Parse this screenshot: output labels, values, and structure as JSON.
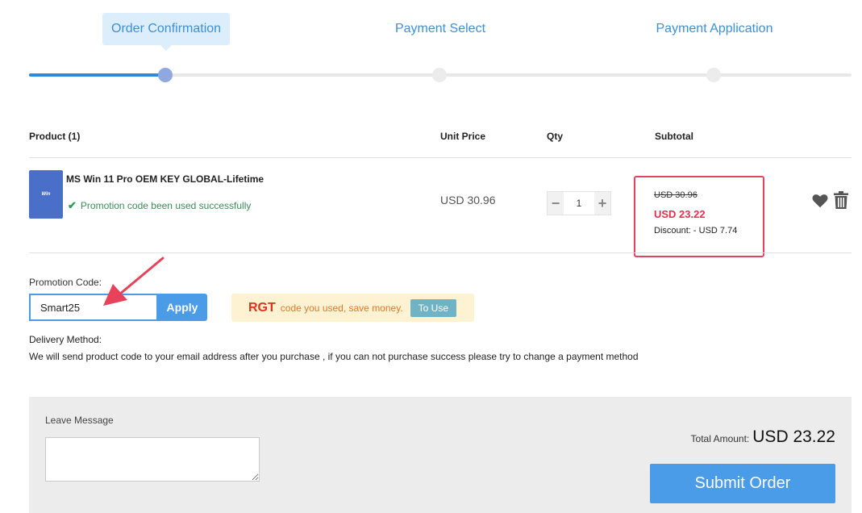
{
  "steps": [
    {
      "label": "Order Confirmation",
      "active": true
    },
    {
      "label": "Payment Select",
      "active": false
    },
    {
      "label": "Payment Application",
      "active": false
    }
  ],
  "table": {
    "headers": {
      "product": "Product (1)",
      "unit_price": "Unit Price",
      "qty": "Qty",
      "subtotal": "Subtotal"
    },
    "item": {
      "thumb_text": "Win",
      "name": "MS Win 11 Pro OEM KEY GLOBAL-Lifetime",
      "promo_status": "Promotion code been used successfully",
      "unit_price": "USD 30.96",
      "qty": "1",
      "minus": "−",
      "plus": "+",
      "old_price": "USD 30.96",
      "new_price": "USD 23.22",
      "discount": "Discount: - USD 7.74"
    }
  },
  "promo": {
    "label": "Promotion Code:",
    "value": "Smart25",
    "apply_label": "Apply",
    "coupon_code": "RGT",
    "coupon_text": "code you used, save money.",
    "to_use_label": "To Use"
  },
  "delivery": {
    "label": "Delivery Method:",
    "text": "We will send product code to your email address after you purchase , if you can not purchase success please try to change a payment method"
  },
  "message": {
    "label": "Leave Message"
  },
  "summary": {
    "total_label": "Total Amount:",
    "total_value": "USD 23.22",
    "submit_label": "Submit Order"
  },
  "colors": {
    "accent": "#4a9be8",
    "highlight_border": "#e0455f",
    "price_red": "#e0324e",
    "annotation_arrow": "#e8415a"
  },
  "icons": [
    "check-icon",
    "heart-icon",
    "trash-icon",
    "arrow-annotation"
  ]
}
